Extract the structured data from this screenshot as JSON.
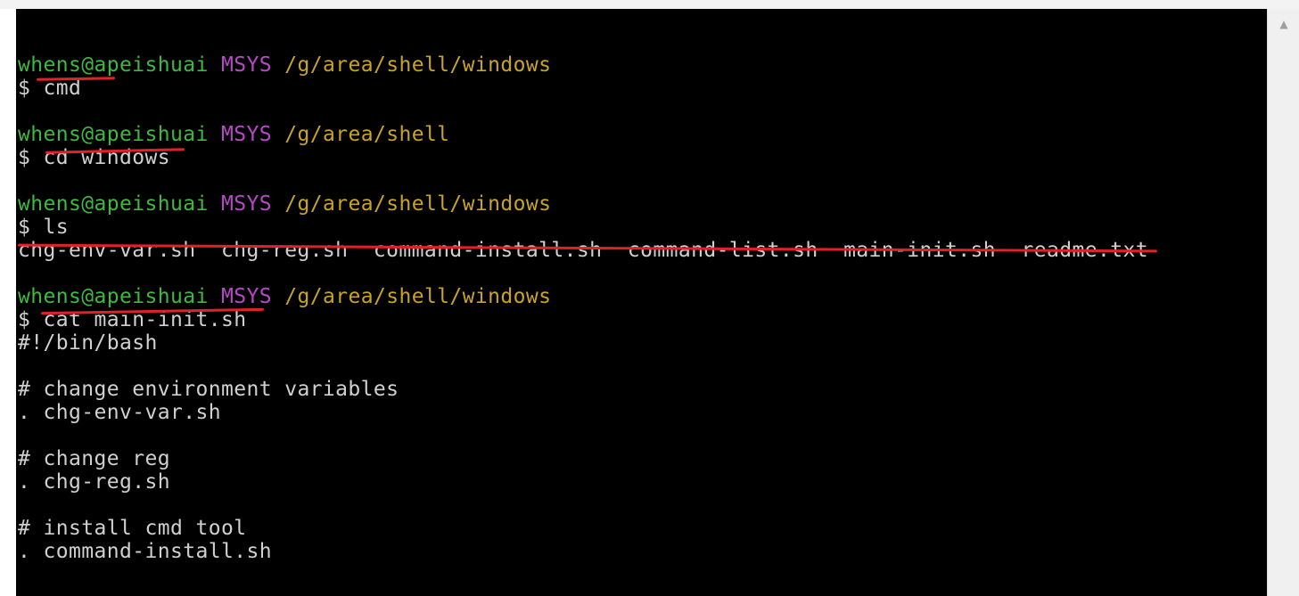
{
  "terminal": {
    "lines": [
      {
        "type": "blank"
      },
      {
        "type": "prompt",
        "user": "whens@apeishuai",
        "sys": "MSYS",
        "path": "/g/area/shell/windows"
      },
      {
        "type": "text",
        "text": "$ cmd"
      },
      {
        "type": "blank"
      },
      {
        "type": "prompt",
        "user": "whens@apeishuai",
        "sys": "MSYS",
        "path": "/g/area/shell"
      },
      {
        "type": "text",
        "text": "$ cd windows"
      },
      {
        "type": "blank"
      },
      {
        "type": "prompt",
        "user": "whens@apeishuai",
        "sys": "MSYS",
        "path": "/g/area/shell/windows"
      },
      {
        "type": "text",
        "text": "$ ls"
      },
      {
        "type": "text",
        "text": "chg-env-var.sh  chg-reg.sh  command-install.sh  command-list.sh  main-init.sh  readme.txt"
      },
      {
        "type": "blank"
      },
      {
        "type": "prompt",
        "user": "whens@apeishuai",
        "sys": "MSYS",
        "path": "/g/area/shell/windows"
      },
      {
        "type": "text",
        "text": "$ cat main-init.sh"
      },
      {
        "type": "text",
        "text": "#!/bin/bash"
      },
      {
        "type": "blank"
      },
      {
        "type": "text",
        "text": "# change environment variables"
      },
      {
        "type": "text",
        "text": ". chg-env-var.sh"
      },
      {
        "type": "blank"
      },
      {
        "type": "text",
        "text": "# change reg"
      },
      {
        "type": "text",
        "text": ". chg-reg.sh"
      },
      {
        "type": "blank"
      },
      {
        "type": "text",
        "text": "# install cmd tool"
      },
      {
        "type": "text",
        "text": ". command-install.sh"
      }
    ]
  },
  "colors": {
    "background": "#000000",
    "user": "#3fb83f",
    "system": "#b548c6",
    "path": "#c9a326",
    "text": "#d0d0d0",
    "annotation_underline": "#e0202a"
  },
  "scrollbar": {
    "up_arrow_icon": "chevron-up-icon",
    "up_arrow_glyph": "▲"
  }
}
